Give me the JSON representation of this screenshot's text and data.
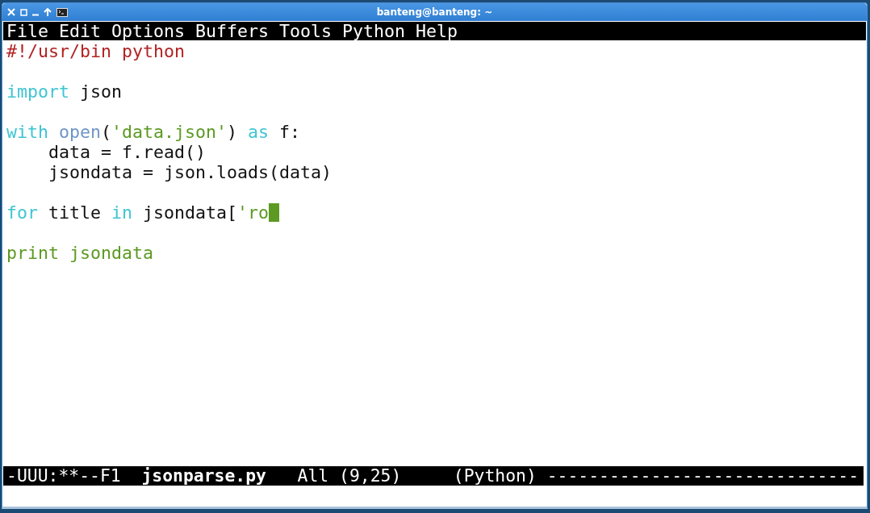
{
  "window": {
    "title": "banteng@banteng: ~"
  },
  "menu_bar": [
    {
      "label": "File"
    },
    {
      "label": "Edit"
    },
    {
      "label": "Options"
    },
    {
      "label": "Buffers"
    },
    {
      "label": "Tools"
    },
    {
      "label": "Python"
    },
    {
      "label": "Help"
    }
  ],
  "editor": {
    "lines": [
      {
        "kind": "code",
        "tokens": [
          {
            "kind": "comment",
            "text": "#!/usr/bin python"
          }
        ]
      },
      {
        "kind": "blank"
      },
      {
        "kind": "code",
        "tokens": [
          {
            "kind": "keyword",
            "text": "import"
          },
          {
            "kind": "plain",
            "text": " json"
          }
        ]
      },
      {
        "kind": "blank"
      },
      {
        "kind": "code",
        "tokens": [
          {
            "kind": "keyword",
            "text": "with "
          },
          {
            "kind": "builtin",
            "text": "open"
          },
          {
            "kind": "plain",
            "text": "("
          },
          {
            "kind": "string",
            "text": "'data.json'"
          },
          {
            "kind": "plain",
            "text": ") "
          },
          {
            "kind": "keyword",
            "text": "as"
          },
          {
            "kind": "plain",
            "text": " f:"
          }
        ]
      },
      {
        "kind": "code",
        "tokens": [
          {
            "kind": "plain",
            "text": "    data = f.read()"
          }
        ]
      },
      {
        "kind": "code",
        "tokens": [
          {
            "kind": "plain",
            "text": "    jsondata = json.loads(data)"
          }
        ]
      },
      {
        "kind": "blank"
      },
      {
        "kind": "code",
        "tokens": [
          {
            "kind": "keyword",
            "text": "for"
          },
          {
            "kind": "plain",
            "text": " title "
          },
          {
            "kind": "keyword",
            "text": "in"
          },
          {
            "kind": "plain",
            "text": " jsondata["
          },
          {
            "kind": "string",
            "text": "'ro"
          },
          {
            "kind": "cursor"
          }
        ]
      },
      {
        "kind": "blank"
      },
      {
        "kind": "code",
        "tokens": [
          {
            "kind": "string",
            "text": "print jsondata"
          }
        ]
      }
    ]
  },
  "mode_line": {
    "status": "-UUU:**--F1",
    "buffer": "jsonparse.py",
    "position": "All (9,25)",
    "mode": "(Python)",
    "fill": "------------------------------"
  }
}
